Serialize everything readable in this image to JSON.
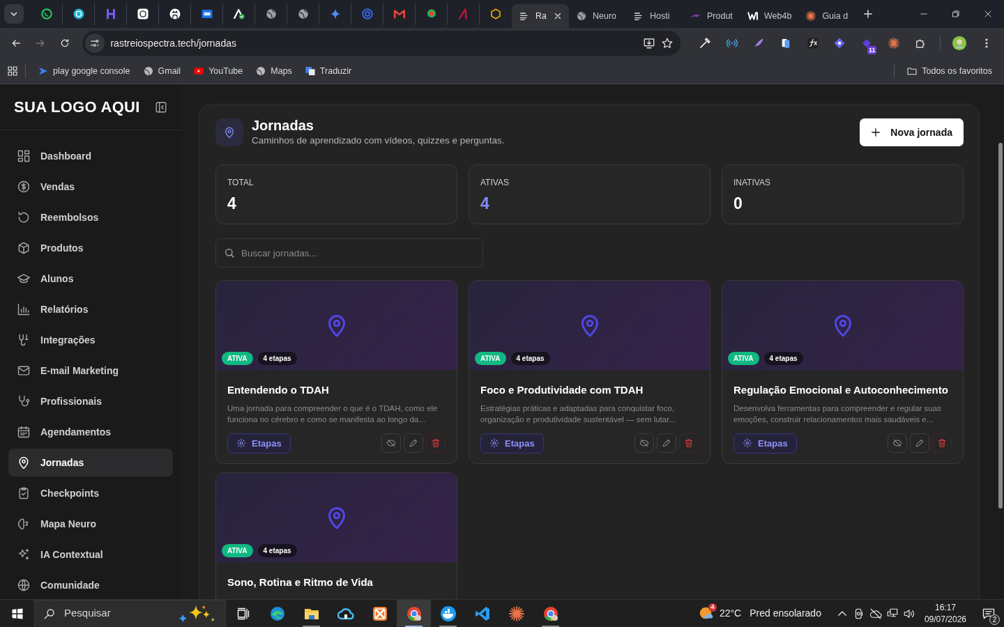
{
  "browser": {
    "tabs": [
      {
        "title": "Ra",
        "selected": true
      },
      {
        "title": "Neuro",
        "selected": false
      },
      {
        "title": "Hosti",
        "selected": false
      },
      {
        "title": "Produt",
        "selected": false
      },
      {
        "title": "Web4b",
        "selected": false
      },
      {
        "title": "Guia d",
        "selected": false
      }
    ],
    "address": "rastreiospectra.tech/jornadas",
    "extension_badge": "11",
    "bookmarks": [
      "play google console",
      "Gmail",
      "YouTube",
      "Maps",
      "Traduzir"
    ],
    "all_bookmarks": "Todos os favoritos"
  },
  "sidebar": {
    "logo": "SUA LOGO AQUI",
    "items": [
      {
        "label": "Dashboard",
        "selected": false
      },
      {
        "label": "Vendas",
        "selected": false
      },
      {
        "label": "Reembolsos",
        "selected": false
      },
      {
        "label": "Produtos",
        "selected": false
      },
      {
        "label": "Alunos",
        "selected": false
      },
      {
        "label": "Relatórios",
        "selected": false
      },
      {
        "label": "Integrações",
        "selected": false
      },
      {
        "label": "E-mail Marketing",
        "selected": false
      },
      {
        "label": "Profissionais",
        "selected": false
      },
      {
        "label": "Agendamentos",
        "selected": false
      },
      {
        "label": "Jornadas",
        "selected": true
      },
      {
        "label": "Checkpoints",
        "selected": false
      },
      {
        "label": "Mapa Neuro",
        "selected": false
      },
      {
        "label": "IA Contextual",
        "selected": false
      },
      {
        "label": "Comunidade",
        "selected": false
      }
    ]
  },
  "header": {
    "title": "Jornadas",
    "subtitle": "Caminhos de aprendizado com vídeos, quizzes e perguntas.",
    "button": "Nova jornada"
  },
  "stats": [
    {
      "label": "TOTAL",
      "value": "4",
      "color": "#ffffff"
    },
    {
      "label": "ATIVAS",
      "value": "4",
      "color": "#818cf8"
    },
    {
      "label": "INATIVAS",
      "value": "0",
      "color": "#ffffff"
    }
  ],
  "search": {
    "placeholder": "Buscar jornadas..."
  },
  "journeys": [
    {
      "status": "ATIVA",
      "active": true,
      "steps": "4 etapas",
      "title": "Entendendo o TDAH",
      "description": "Uma jornada para compreender o que é o TDAH, como ele funciona no cérebro e como se manifesta ao longo da...",
      "button": "Etapas"
    },
    {
      "status": "ATIVA",
      "active": true,
      "steps": "4 etapas",
      "title": "Foco e Produtividade com TDAH",
      "description": "Estratégias práticas e adaptadas para conquistar foco, organização e produtividade sustentável — sem lutar...",
      "button": "Etapas"
    },
    {
      "status": "ATIVA",
      "active": true,
      "steps": "4 etapas",
      "title": "Regulação Emocional e Autoconhecimento",
      "description": "Desenvolva ferramentas para compreender e regular suas emoções, construir relacionamentos mais saudáveis e...",
      "button": "Etapas"
    },
    {
      "status": "ATIVA",
      "active": true,
      "steps": "4 etapas",
      "title": "Sono, Rotina e Ritmo de Vida"
    }
  ],
  "taskbar": {
    "search_placeholder": "Pesquisar",
    "apps": [
      {
        "running": false,
        "selected": false
      },
      {
        "running": true,
        "selected": false
      },
      {
        "running": false,
        "selected": false
      },
      {
        "running": false,
        "selected": false
      },
      {
        "running": true,
        "selected": true
      },
      {
        "running": true,
        "selected": false
      },
      {
        "running": false,
        "selected": false
      },
      {
        "running": false,
        "selected": false
      },
      {
        "running": true,
        "selected": false
      }
    ],
    "weather_badge": "4",
    "temperature": "22°C",
    "weather": "Pred ensolarado",
    "time": "16:17",
    "date": "09/07/2026",
    "notifications": "2"
  }
}
